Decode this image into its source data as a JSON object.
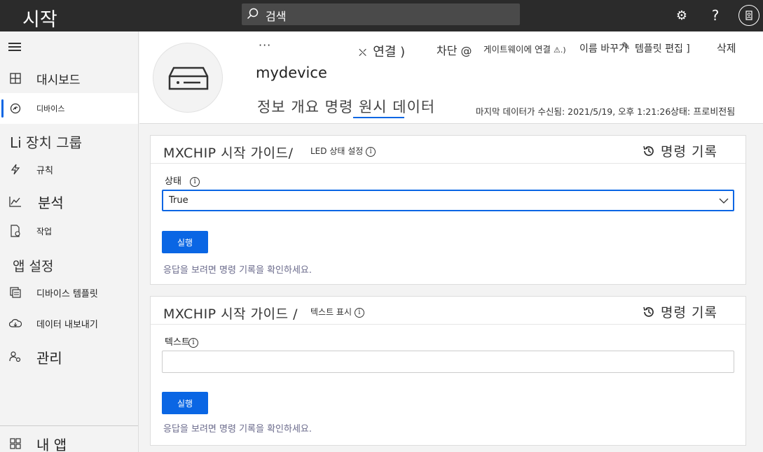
{
  "topbar": {
    "app_title": "시작",
    "search_placeholder": "검색"
  },
  "sidebar": {
    "items": [
      {
        "label": "대시보드",
        "icon": "dashboard-icon"
      },
      {
        "label": "디바이스",
        "icon": "devices-icon",
        "active": true
      },
      {
        "label": "Li 장치 그룹",
        "icon": "none"
      },
      {
        "label": "규칙",
        "icon": "rules-icon"
      },
      {
        "label": "분석",
        "icon": "analytics-icon"
      },
      {
        "label": "작업",
        "icon": "jobs-icon"
      },
      {
        "label": "앱 설정",
        "icon": "none"
      },
      {
        "label": "디바이스 템플릿",
        "icon": "device-template-icon"
      },
      {
        "label": "데이터 내보내기",
        "icon": "data-export-icon"
      },
      {
        "label": "관리",
        "icon": "admin-icon"
      },
      {
        "label": "내 앱",
        "icon": "my-apps-icon"
      }
    ]
  },
  "header": {
    "more": "···",
    "toolbar": {
      "connect": "연결 )",
      "block": "차단 @",
      "gateway": "게이트웨이에 연결",
      "rename": "이름 바꾸기",
      "edit_template": "템플릿 편집 ]",
      "delete": "삭제"
    },
    "device_name": "mydevice",
    "tabs": "정보 개요 명령 원시 데이터",
    "last_data": "마지막 데이터가 수신됨: 2021/5/19, 오후 1:21:26",
    "status": "상태: 프로비전됨"
  },
  "cards": [
    {
      "title": "MXCHIP 시작 가이드/",
      "subtitle": "LED 상태 설정",
      "history": "명령 기록",
      "field_label": "상태",
      "field_value": "True",
      "run_label": "실행",
      "hint": "응답을 보려면 명령 기록을 확인하세요."
    },
    {
      "title": "MXCHIP 시작 가이드 /",
      "subtitle": "텍스트 표시",
      "history": "명령 기록",
      "field_label": "텍스트",
      "field_value": "",
      "run_label": "실행",
      "hint": "응답을 보려면 명령 기록을 확인하세요."
    }
  ],
  "colors": {
    "topbar_bg": "#2b2b2b",
    "accent": "#0a66e4",
    "hint_text": "#6b6b8c"
  }
}
